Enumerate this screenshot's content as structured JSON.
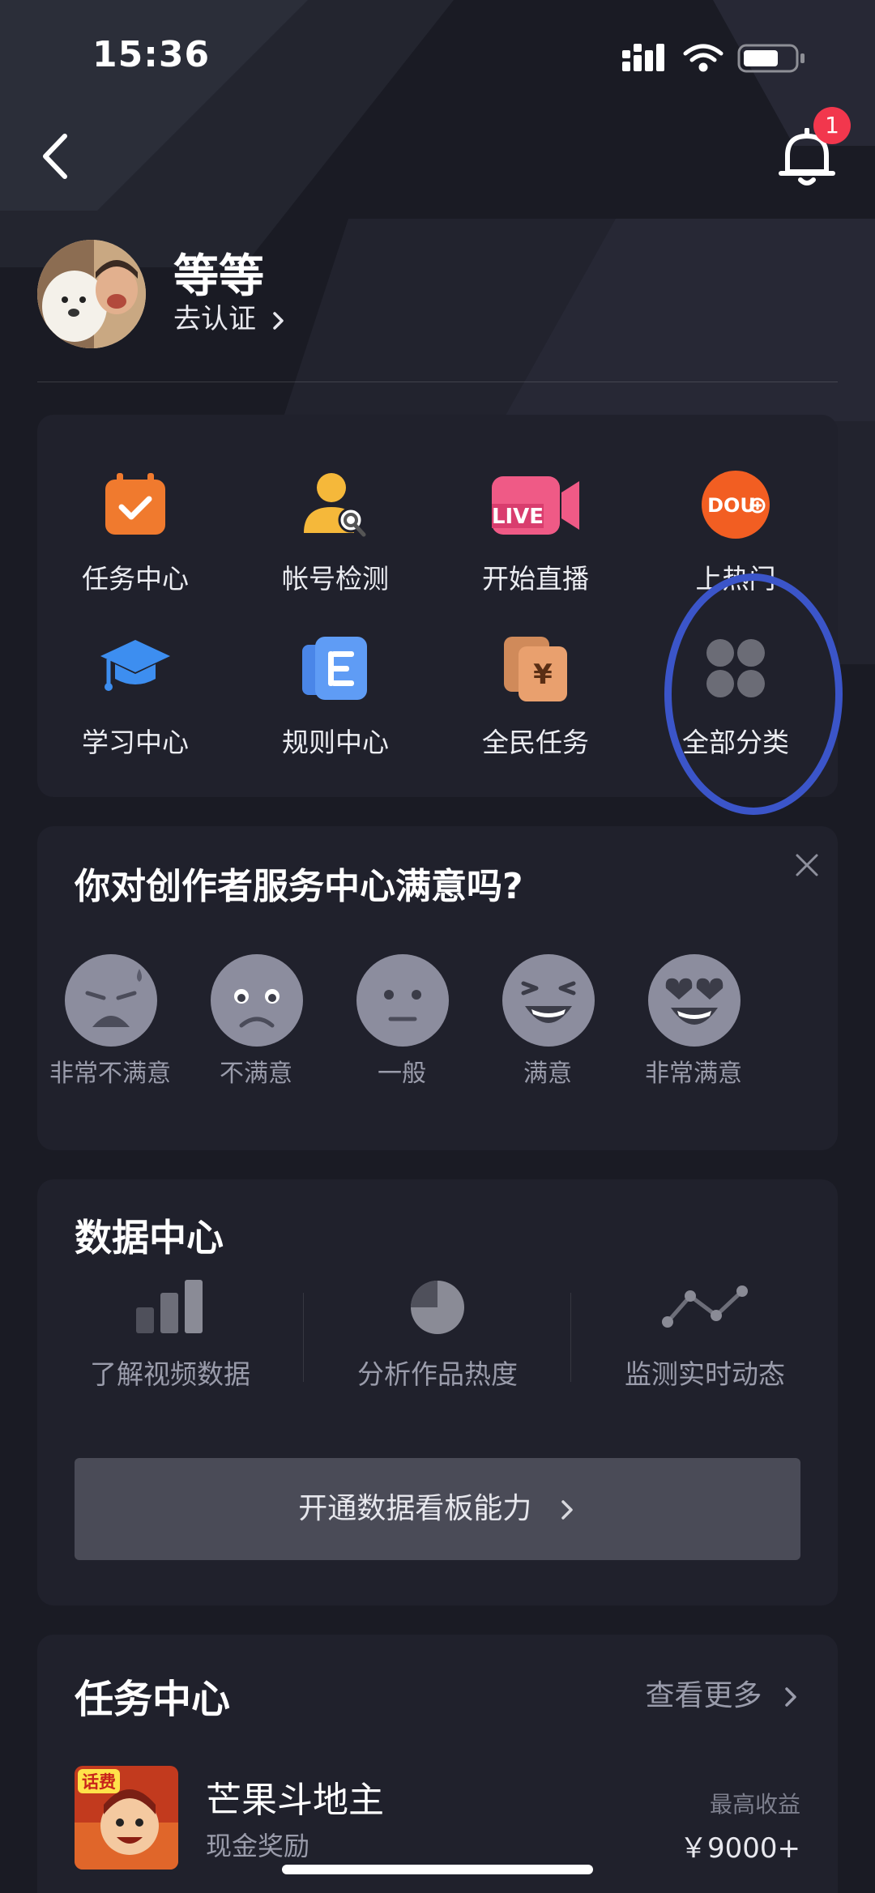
{
  "status": {
    "time": "15:36"
  },
  "notifications": {
    "badge": "1"
  },
  "profile": {
    "name": "等等",
    "verify_link": "去认证"
  },
  "services": [
    {
      "label": "任务中心",
      "icon": "task-calendar-icon"
    },
    {
      "label": "帐号检测",
      "icon": "account-check-icon"
    },
    {
      "label": "开始直播",
      "icon": "live-camera-icon"
    },
    {
      "label": "上热门",
      "icon": "dou-plus-icon"
    },
    {
      "label": "学习中心",
      "icon": "graduation-cap-icon"
    },
    {
      "label": "规则中心",
      "icon": "rules-book-icon"
    },
    {
      "label": "全民任务",
      "icon": "yuan-task-icon"
    },
    {
      "label": "全部分类",
      "icon": "all-categories-icon"
    }
  ],
  "survey": {
    "title": "你对创作者服务中心满意吗?",
    "options": [
      {
        "label": "非常不满意",
        "icon": "very-dissatisfied-face-icon"
      },
      {
        "label": "不满意",
        "icon": "dissatisfied-face-icon"
      },
      {
        "label": "一般",
        "icon": "neutral-face-icon"
      },
      {
        "label": "满意",
        "icon": "satisfied-face-icon"
      },
      {
        "label": "非常满意",
        "icon": "very-satisfied-face-icon"
      }
    ]
  },
  "data_center": {
    "title": "数据中心",
    "items": [
      {
        "label": "了解视频数据",
        "icon": "bar-chart-icon"
      },
      {
        "label": "分析作品热度",
        "icon": "pie-chart-icon"
      },
      {
        "label": "监测实时动态",
        "icon": "line-chart-icon"
      }
    ],
    "cta": "开通数据看板能力"
  },
  "tasks": {
    "title": "任务中心",
    "more": "查看更多",
    "items": [
      {
        "name": "芒果斗地主",
        "subtitle": "现金奖励",
        "cap_label": "最高收益",
        "amount": "￥9000+",
        "badge": "话费"
      }
    ]
  },
  "colors": {
    "background": "#1a1b24",
    "card": "#20212c",
    "highlight": "#3b55c9",
    "badge": "#f2374d"
  }
}
